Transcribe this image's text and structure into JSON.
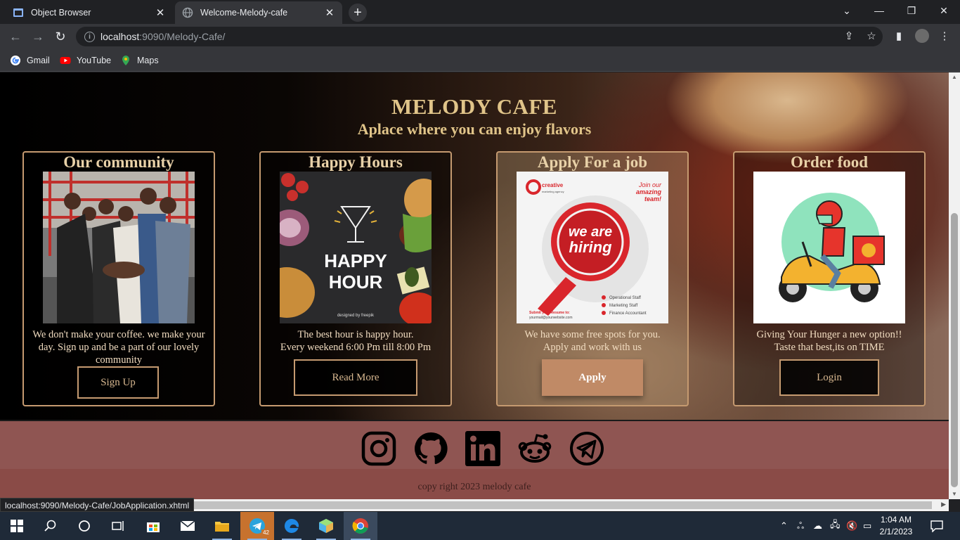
{
  "browser": {
    "tabs": [
      {
        "title": "Object Browser",
        "active": false
      },
      {
        "title": "Welcome-Melody-cafe",
        "active": true
      }
    ],
    "url_host": "localhost",
    "url_rest": ":9090/Melody-Cafe/",
    "bookmarks": [
      {
        "label": "Gmail",
        "icon": "google-icon"
      },
      {
        "label": "YouTube",
        "icon": "youtube-icon"
      },
      {
        "label": "Maps",
        "icon": "maps-icon"
      }
    ],
    "status_url": "localhost:9090/Melody-Cafe/JobApplication.xhtml"
  },
  "page": {
    "title": "MELODY CAFE",
    "subtitle": "Aplace where you can enjoy flavors",
    "cards": [
      {
        "title": "Our community",
        "desc": "We don't make your coffee. we make your day. Sign up and be a part of our lovely community",
        "button": "Sign Up",
        "image": "community-photo"
      },
      {
        "title": "Happy Hours",
        "desc_line1": "The best hour is happy hour.",
        "desc_line2": "Every weekend 6:00 Pm till 8:00 Pm",
        "button": "Read More",
        "image": "happy-hour-poster",
        "poster_line1": "HAPPY",
        "poster_line2": "HOUR",
        "poster_credit": "designed by freepik"
      },
      {
        "title": "Apply For a job",
        "desc_line1": "We have some free spots for you.",
        "desc_line2": "Apply and work with us",
        "button": "Apply",
        "image": "hiring-poster",
        "poster": {
          "brand": "creative",
          "brand_sub": "marketing agency",
          "join1": "Join our",
          "join2": "amazing",
          "join3": "team!",
          "btn1": "we are",
          "btn2": "hiring",
          "positions": [
            "Operational Staff",
            "Marketing Staff",
            "Finance Accountant"
          ],
          "submit": "Submit your Resume to:",
          "email": "yourmail@yourwebsite.com"
        }
      },
      {
        "title": "Order food",
        "desc_line1": "Giving Your Hunger a new option!!",
        "desc_line2": "Taste that best,its on TIME",
        "button": "Login",
        "image": "delivery-illustration"
      }
    ],
    "social": [
      "instagram-icon",
      "github-icon",
      "linkedin-icon",
      "reddit-icon",
      "telegram-icon"
    ],
    "copyright": "copy right 2023 melody cafe"
  },
  "taskbar": {
    "telegram_badge": "42",
    "time": "1:04 AM",
    "date": "2/1/2023"
  }
}
